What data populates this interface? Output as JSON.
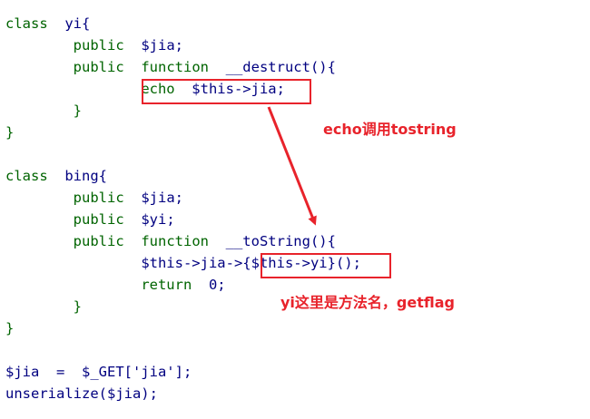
{
  "code_lines": [
    {
      "indent": "",
      "tokens": [
        {
          "t": "class",
          "c": "kw"
        },
        {
          "t": "  yi{",
          "c": "id"
        }
      ]
    },
    {
      "indent": "        ",
      "tokens": [
        {
          "t": "public",
          "c": "kw"
        },
        {
          "t": "  $jia;",
          "c": "id"
        }
      ]
    },
    {
      "indent": "        ",
      "tokens": [
        {
          "t": "public",
          "c": "kw"
        },
        {
          "t": "  ",
          "c": "id"
        },
        {
          "t": "function",
          "c": "kw"
        },
        {
          "t": "  __destruct(){",
          "c": "id"
        }
      ]
    },
    {
      "indent": "                ",
      "tokens": [
        {
          "t": "echo",
          "c": "kw"
        },
        {
          "t": "  $this->jia;",
          "c": "id"
        }
      ]
    },
    {
      "indent": "        ",
      "tokens": [
        {
          "t": "}",
          "c": "kw"
        }
      ]
    },
    {
      "indent": "",
      "tokens": [
        {
          "t": "}",
          "c": "kw"
        }
      ]
    },
    {
      "indent": "",
      "tokens": []
    },
    {
      "indent": "",
      "tokens": [
        {
          "t": "class",
          "c": "kw"
        },
        {
          "t": "  bing{",
          "c": "id"
        }
      ]
    },
    {
      "indent": "        ",
      "tokens": [
        {
          "t": "public",
          "c": "kw"
        },
        {
          "t": "  $jia;",
          "c": "id"
        }
      ]
    },
    {
      "indent": "        ",
      "tokens": [
        {
          "t": "public",
          "c": "kw"
        },
        {
          "t": "  $yi;",
          "c": "id"
        }
      ]
    },
    {
      "indent": "        ",
      "tokens": [
        {
          "t": "public",
          "c": "kw"
        },
        {
          "t": "  ",
          "c": "id"
        },
        {
          "t": "function",
          "c": "kw"
        },
        {
          "t": "  __toString(){",
          "c": "id"
        }
      ]
    },
    {
      "indent": "                ",
      "tokens": [
        {
          "t": "$this->jia->{$this->yi}();",
          "c": "id"
        }
      ]
    },
    {
      "indent": "                ",
      "tokens": [
        {
          "t": "return",
          "c": "kw"
        },
        {
          "t": "  0;",
          "c": "id"
        }
      ]
    },
    {
      "indent": "        ",
      "tokens": [
        {
          "t": "}",
          "c": "kw"
        }
      ]
    },
    {
      "indent": "",
      "tokens": [
        {
          "t": "}",
          "c": "kw"
        }
      ]
    },
    {
      "indent": "",
      "tokens": []
    },
    {
      "indent": "",
      "tokens": [
        {
          "t": "$jia  =  $_GET['jia'];",
          "c": "id"
        }
      ]
    },
    {
      "indent": "",
      "tokens": [
        {
          "t": "unserialize($jia);",
          "c": "id"
        }
      ]
    }
  ],
  "annotations": {
    "echo_note": "echo调用tostring",
    "yi_note": "yi这里是方法名，getflag"
  },
  "colors": {
    "keyword": "#006400",
    "identifier": "#000080",
    "highlight": "#e8232b"
  }
}
